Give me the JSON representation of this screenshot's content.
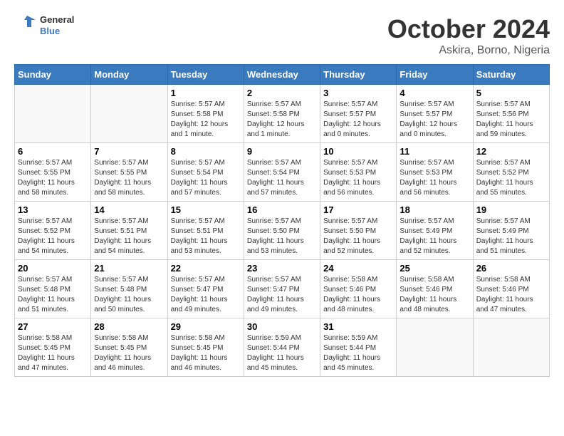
{
  "header": {
    "logo_general": "General",
    "logo_blue": "Blue",
    "title": "October 2024",
    "subtitle": "Askira, Borno, Nigeria"
  },
  "calendar": {
    "weekdays": [
      "Sunday",
      "Monday",
      "Tuesday",
      "Wednesday",
      "Thursday",
      "Friday",
      "Saturday"
    ],
    "weeks": [
      [
        {
          "day": "",
          "sunrise": "",
          "sunset": "",
          "daylight": ""
        },
        {
          "day": "",
          "sunrise": "",
          "sunset": "",
          "daylight": ""
        },
        {
          "day": "1",
          "sunrise": "Sunrise: 5:57 AM",
          "sunset": "Sunset: 5:58 PM",
          "daylight": "Daylight: 12 hours and 1 minute."
        },
        {
          "day": "2",
          "sunrise": "Sunrise: 5:57 AM",
          "sunset": "Sunset: 5:58 PM",
          "daylight": "Daylight: 12 hours and 1 minute."
        },
        {
          "day": "3",
          "sunrise": "Sunrise: 5:57 AM",
          "sunset": "Sunset: 5:57 PM",
          "daylight": "Daylight: 12 hours and 0 minutes."
        },
        {
          "day": "4",
          "sunrise": "Sunrise: 5:57 AM",
          "sunset": "Sunset: 5:57 PM",
          "daylight": "Daylight: 12 hours and 0 minutes."
        },
        {
          "day": "5",
          "sunrise": "Sunrise: 5:57 AM",
          "sunset": "Sunset: 5:56 PM",
          "daylight": "Daylight: 11 hours and 59 minutes."
        }
      ],
      [
        {
          "day": "6",
          "sunrise": "Sunrise: 5:57 AM",
          "sunset": "Sunset: 5:55 PM",
          "daylight": "Daylight: 11 hours and 58 minutes."
        },
        {
          "day": "7",
          "sunrise": "Sunrise: 5:57 AM",
          "sunset": "Sunset: 5:55 PM",
          "daylight": "Daylight: 11 hours and 58 minutes."
        },
        {
          "day": "8",
          "sunrise": "Sunrise: 5:57 AM",
          "sunset": "Sunset: 5:54 PM",
          "daylight": "Daylight: 11 hours and 57 minutes."
        },
        {
          "day": "9",
          "sunrise": "Sunrise: 5:57 AM",
          "sunset": "Sunset: 5:54 PM",
          "daylight": "Daylight: 11 hours and 57 minutes."
        },
        {
          "day": "10",
          "sunrise": "Sunrise: 5:57 AM",
          "sunset": "Sunset: 5:53 PM",
          "daylight": "Daylight: 11 hours and 56 minutes."
        },
        {
          "day": "11",
          "sunrise": "Sunrise: 5:57 AM",
          "sunset": "Sunset: 5:53 PM",
          "daylight": "Daylight: 11 hours and 56 minutes."
        },
        {
          "day": "12",
          "sunrise": "Sunrise: 5:57 AM",
          "sunset": "Sunset: 5:52 PM",
          "daylight": "Daylight: 11 hours and 55 minutes."
        }
      ],
      [
        {
          "day": "13",
          "sunrise": "Sunrise: 5:57 AM",
          "sunset": "Sunset: 5:52 PM",
          "daylight": "Daylight: 11 hours and 54 minutes."
        },
        {
          "day": "14",
          "sunrise": "Sunrise: 5:57 AM",
          "sunset": "Sunset: 5:51 PM",
          "daylight": "Daylight: 11 hours and 54 minutes."
        },
        {
          "day": "15",
          "sunrise": "Sunrise: 5:57 AM",
          "sunset": "Sunset: 5:51 PM",
          "daylight": "Daylight: 11 hours and 53 minutes."
        },
        {
          "day": "16",
          "sunrise": "Sunrise: 5:57 AM",
          "sunset": "Sunset: 5:50 PM",
          "daylight": "Daylight: 11 hours and 53 minutes."
        },
        {
          "day": "17",
          "sunrise": "Sunrise: 5:57 AM",
          "sunset": "Sunset: 5:50 PM",
          "daylight": "Daylight: 11 hours and 52 minutes."
        },
        {
          "day": "18",
          "sunrise": "Sunrise: 5:57 AM",
          "sunset": "Sunset: 5:49 PM",
          "daylight": "Daylight: 11 hours and 52 minutes."
        },
        {
          "day": "19",
          "sunrise": "Sunrise: 5:57 AM",
          "sunset": "Sunset: 5:49 PM",
          "daylight": "Daylight: 11 hours and 51 minutes."
        }
      ],
      [
        {
          "day": "20",
          "sunrise": "Sunrise: 5:57 AM",
          "sunset": "Sunset: 5:48 PM",
          "daylight": "Daylight: 11 hours and 51 minutes."
        },
        {
          "day": "21",
          "sunrise": "Sunrise: 5:57 AM",
          "sunset": "Sunset: 5:48 PM",
          "daylight": "Daylight: 11 hours and 50 minutes."
        },
        {
          "day": "22",
          "sunrise": "Sunrise: 5:57 AM",
          "sunset": "Sunset: 5:47 PM",
          "daylight": "Daylight: 11 hours and 49 minutes."
        },
        {
          "day": "23",
          "sunrise": "Sunrise: 5:57 AM",
          "sunset": "Sunset: 5:47 PM",
          "daylight": "Daylight: 11 hours and 49 minutes."
        },
        {
          "day": "24",
          "sunrise": "Sunrise: 5:58 AM",
          "sunset": "Sunset: 5:46 PM",
          "daylight": "Daylight: 11 hours and 48 minutes."
        },
        {
          "day": "25",
          "sunrise": "Sunrise: 5:58 AM",
          "sunset": "Sunset: 5:46 PM",
          "daylight": "Daylight: 11 hours and 48 minutes."
        },
        {
          "day": "26",
          "sunrise": "Sunrise: 5:58 AM",
          "sunset": "Sunset: 5:46 PM",
          "daylight": "Daylight: 11 hours and 47 minutes."
        }
      ],
      [
        {
          "day": "27",
          "sunrise": "Sunrise: 5:58 AM",
          "sunset": "Sunset: 5:45 PM",
          "daylight": "Daylight: 11 hours and 47 minutes."
        },
        {
          "day": "28",
          "sunrise": "Sunrise: 5:58 AM",
          "sunset": "Sunset: 5:45 PM",
          "daylight": "Daylight: 11 hours and 46 minutes."
        },
        {
          "day": "29",
          "sunrise": "Sunrise: 5:58 AM",
          "sunset": "Sunset: 5:45 PM",
          "daylight": "Daylight: 11 hours and 46 minutes."
        },
        {
          "day": "30",
          "sunrise": "Sunrise: 5:59 AM",
          "sunset": "Sunset: 5:44 PM",
          "daylight": "Daylight: 11 hours and 45 minutes."
        },
        {
          "day": "31",
          "sunrise": "Sunrise: 5:59 AM",
          "sunset": "Sunset: 5:44 PM",
          "daylight": "Daylight: 11 hours and 45 minutes."
        },
        {
          "day": "",
          "sunrise": "",
          "sunset": "",
          "daylight": ""
        },
        {
          "day": "",
          "sunrise": "",
          "sunset": "",
          "daylight": ""
        }
      ]
    ]
  }
}
